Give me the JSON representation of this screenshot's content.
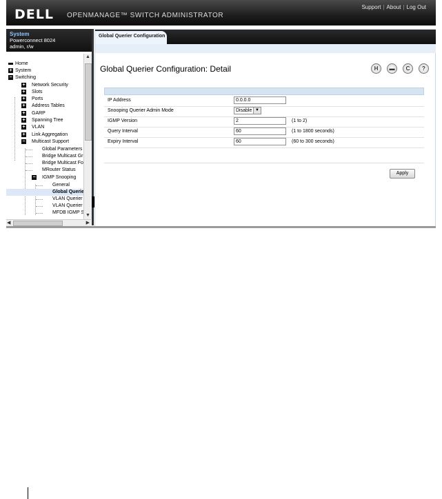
{
  "header": {
    "logo": "DELL",
    "app_title": "OPENMANAGE™ SWITCH ADMINISTRATOR",
    "links": [
      "Support",
      "About",
      "Log Out"
    ],
    "separator": "|"
  },
  "system_info": {
    "heading": "System",
    "model": "Powerconnect 8024",
    "user": "admin, r/w"
  },
  "tree": [
    {
      "label": "Home",
      "toggle": ""
    },
    {
      "label": "System",
      "toggle": "+"
    },
    {
      "label": "Switching",
      "toggle": "−"
    },
    {
      "label": "Network Security",
      "toggle": "+"
    },
    {
      "label": "Slots",
      "toggle": "+"
    },
    {
      "label": "Ports",
      "toggle": "+"
    },
    {
      "label": "Address Tables",
      "toggle": "+"
    },
    {
      "label": "GARP",
      "toggle": "+"
    },
    {
      "label": "Spanning Tree",
      "toggle": "+"
    },
    {
      "label": "VLAN",
      "toggle": "+"
    },
    {
      "label": "Link Aggregation",
      "toggle": "+"
    },
    {
      "label": "Multicast Support",
      "toggle": "−"
    },
    {
      "label": "Global Parameters",
      "toggle": ""
    },
    {
      "label": "Bridge Multicast Gr",
      "toggle": ""
    },
    {
      "label": "Bridge Multicast Fo",
      "toggle": ""
    },
    {
      "label": "MRouter Status",
      "toggle": ""
    },
    {
      "label": "IGMP Snooping",
      "toggle": "−"
    },
    {
      "label": "General",
      "toggle": ""
    },
    {
      "label": "Global Querier",
      "toggle": ""
    },
    {
      "label": "VLAN Querier",
      "toggle": ""
    },
    {
      "label": "VLAN Querier S",
      "toggle": ""
    },
    {
      "label": "MFDB IGMP Sn",
      "toggle": ""
    }
  ],
  "tab": {
    "label": "Global Querier Configuration"
  },
  "page": {
    "title": "Global Querier Configuration: Detail",
    "tools": [
      "save-icon",
      "print-icon",
      "refresh-icon",
      "help-icon"
    ]
  },
  "form": {
    "ip_address": {
      "label": "IP Address",
      "value": "0.0.0.0"
    },
    "admin_mode": {
      "label": "Snooping Querier Admin Mode",
      "value": "Disable"
    },
    "igmp_version": {
      "label": "IGMP Version",
      "value": "2",
      "hint": "(1 to 2)"
    },
    "query_interval": {
      "label": "Query Interval",
      "value": "60",
      "hint": "(1 to 1800 seconds)"
    },
    "expiry_interval": {
      "label": "Expiry Interval",
      "value": "60",
      "hint": "(60 to 300 seconds)"
    }
  },
  "apply_label": "Apply",
  "colors": {
    "header_bg": "#1e1e1e",
    "link": "#8cc6ff",
    "form_header": "#d6e3f1",
    "tab_bg": "#eef4fb"
  }
}
